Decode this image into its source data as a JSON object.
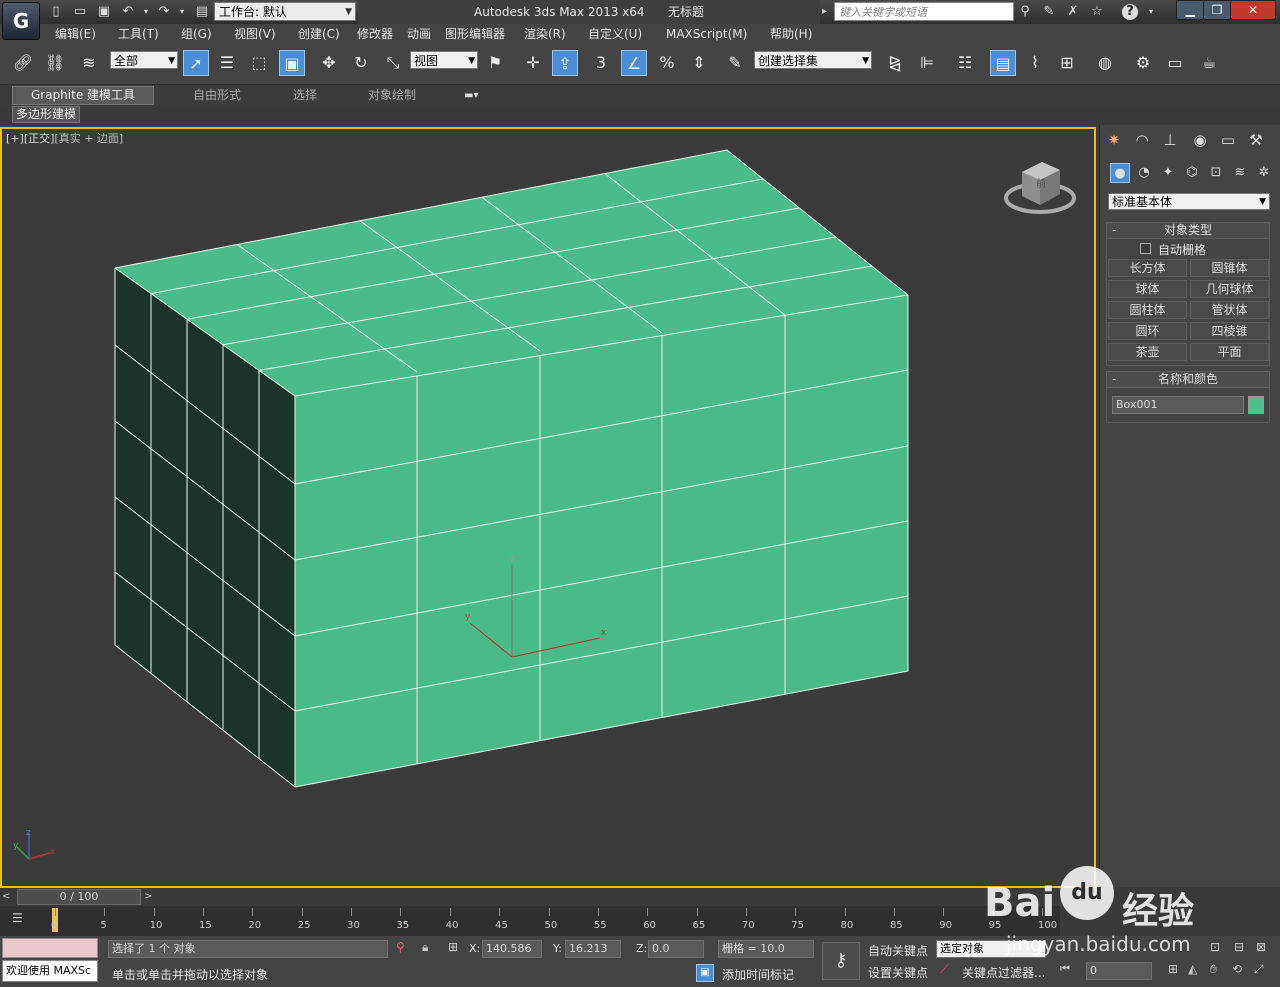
{
  "title_bar": {
    "app_logo": "G",
    "workspace": "工作台: 默认",
    "app_title": "Autodesk 3ds Max  2013 x64",
    "doc_title": "无标题",
    "search_placeholder": "键入关键字或短语"
  },
  "menu": [
    "编辑(E)",
    "工具(T)",
    "组(G)",
    "视图(V)",
    "创建(C)",
    "修改器",
    "动画",
    "图形编辑器",
    "渲染(R)",
    "自定义(U)",
    "MAXScript(M)",
    "帮助(H)"
  ],
  "toolbar": {
    "selection_filter": "全部",
    "ref_coord": "视图",
    "named_selection": "创建选择集",
    "snap_label": "3",
    "percent_label": "%"
  },
  "ribbon": {
    "tabs": [
      "Graphite 建模工具",
      "自由形式",
      "选择",
      "对象绘制"
    ],
    "sub_tab": "多边形建模"
  },
  "viewport": {
    "label_plus": "[+]",
    "label_view": "[正交]",
    "label_shading": "[真实 + 边面]",
    "gizmo_z": "z",
    "gizmo_y": "y",
    "gizmo_x": "x",
    "axis_z": "z",
    "axis_y": "y",
    "axis_x": "x",
    "viewcube_label": "前"
  },
  "command_panel": {
    "category": "标准基本体",
    "object_type_title": "对象类型",
    "auto_grid": "自动栅格",
    "object_buttons": [
      "长方体",
      "圆锥体",
      "球体",
      "几何球体",
      "圆柱体",
      "管状体",
      "圆环",
      "四棱锥",
      "茶壶",
      "平面"
    ],
    "name_color_title": "名称和颜色",
    "object_name": "Box001",
    "object_color": "#4cc08c"
  },
  "timeline": {
    "frame_display": "0 / 100",
    "ticks": [
      "0",
      "5",
      "10",
      "15",
      "20",
      "25",
      "30",
      "35",
      "40",
      "45",
      "50",
      "55",
      "60",
      "65",
      "70",
      "75",
      "80",
      "85",
      "90",
      "95",
      "100"
    ]
  },
  "status": {
    "welcome": "欢迎使用 MAXSc",
    "selection_info": "选择了 1 个 对象",
    "prompt": "单击或单击并拖动以选择对象",
    "x_label": "X:",
    "x_value": "140.586",
    "y_label": "Y:",
    "y_value": "16.213",
    "z_label": "Z:",
    "z_value": "0.0",
    "grid": "栅格 = 10.0",
    "auto_key": "自动关键点",
    "selected_dropdown": "选定对象",
    "set_key": "设置关键点",
    "key_filters": "关键点过滤器...",
    "add_time_tag": "添加时间标记",
    "current_frame": "0"
  },
  "watermark": {
    "brand": "Bai",
    "paw": "du",
    "product": "经验",
    "url": "jingyan.baidu.com"
  }
}
